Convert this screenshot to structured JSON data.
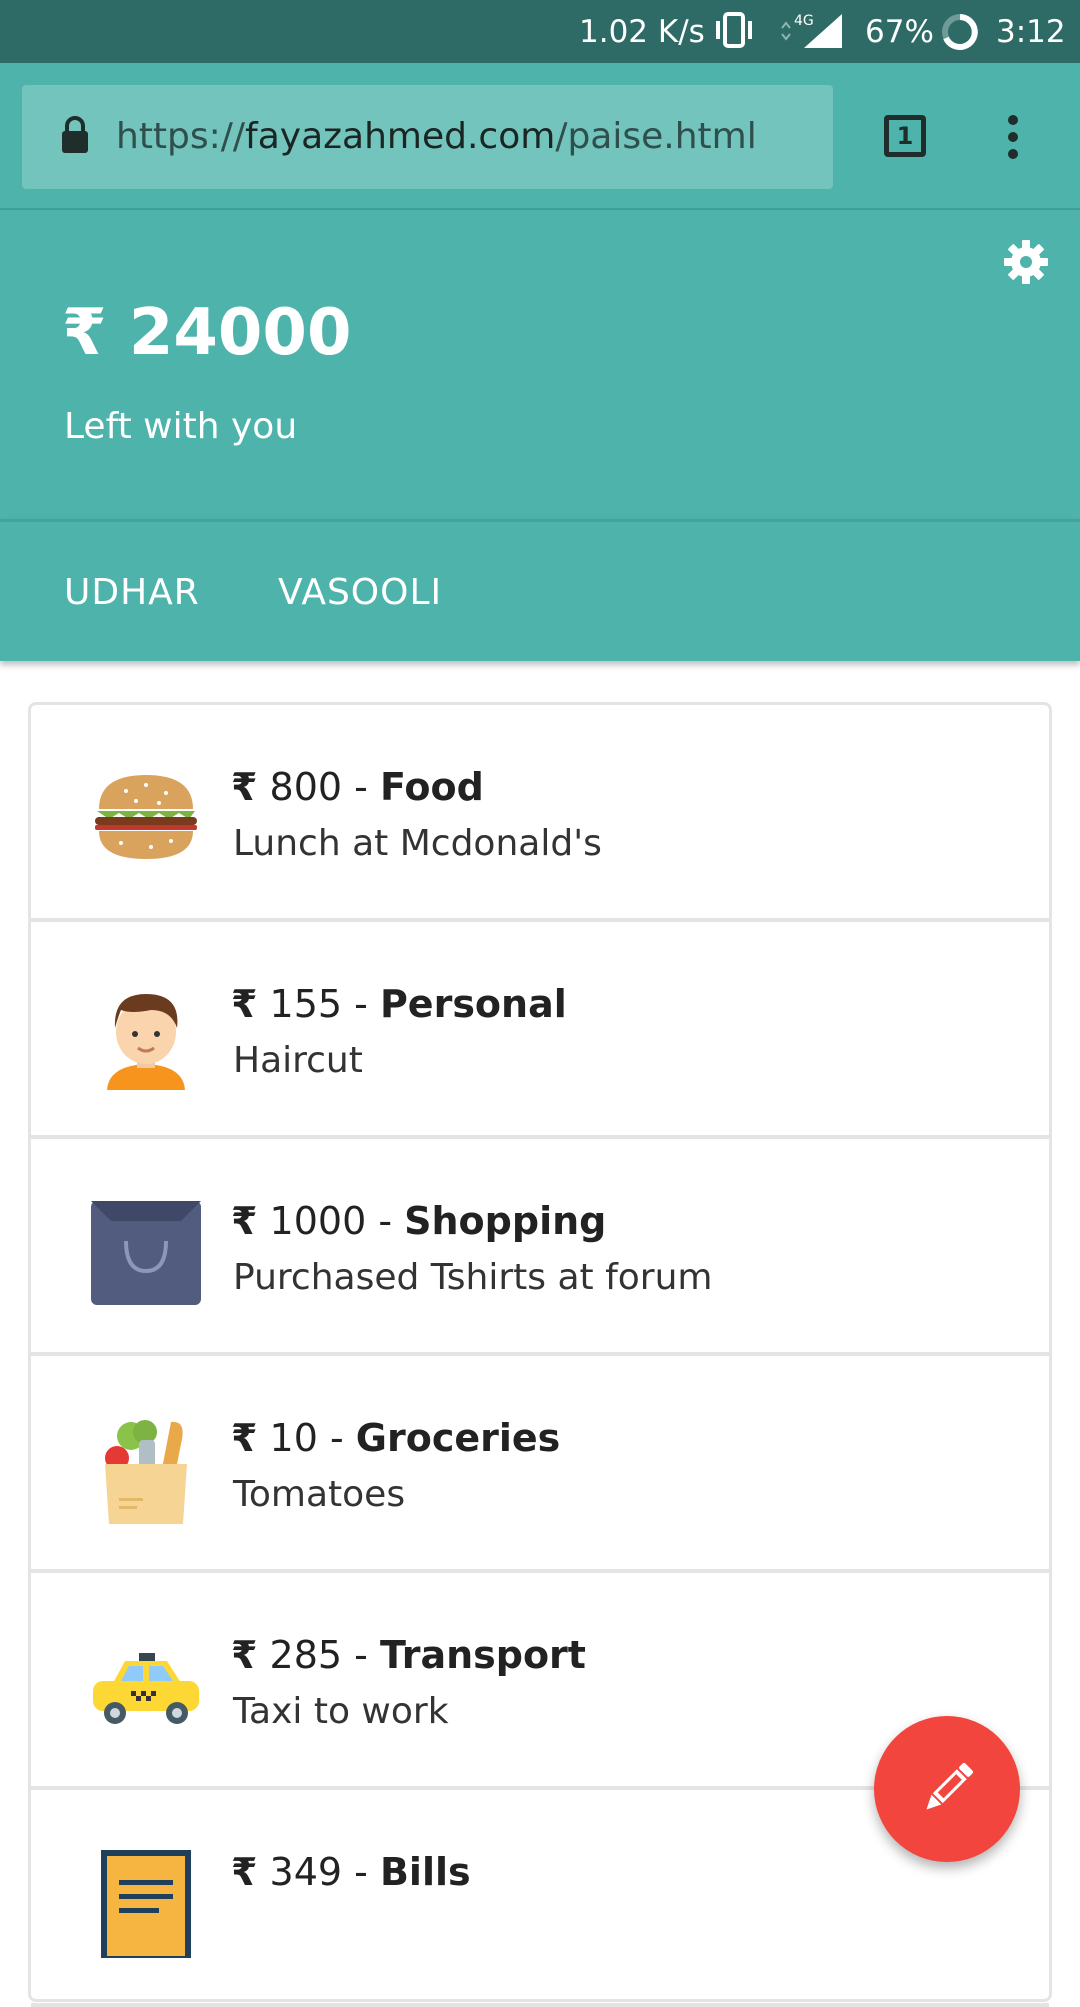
{
  "status_bar": {
    "network_speed": "1.02 K/s",
    "network_type": "4G",
    "battery": "67%",
    "time": "3:12"
  },
  "browser": {
    "url_scheme": "https://",
    "url_domain": "fayazahmed.com",
    "url_path": "/paise.html",
    "tab_count": "1"
  },
  "header": {
    "currency_symbol": "₹",
    "balance_amount": "24000",
    "balance_label": "Left with you",
    "tabs": [
      "UDHAR",
      "VASOOLI"
    ]
  },
  "expenses": [
    {
      "amount": "800",
      "category": "Food",
      "note": "Lunch at Mcdonald's",
      "icon": "burger-icon"
    },
    {
      "amount": "155",
      "category": "Personal",
      "note": "Haircut",
      "icon": "person-avatar-icon"
    },
    {
      "amount": "1000",
      "category": "Shopping",
      "note": "Purchased Tshirts at forum",
      "icon": "shopping-bag-icon"
    },
    {
      "amount": "10",
      "category": "Groceries",
      "note": "Tomatoes",
      "icon": "grocery-bag-icon"
    },
    {
      "amount": "285",
      "category": "Transport",
      "note": "Taxi to work",
      "icon": "taxi-icon"
    },
    {
      "amount": "349",
      "category": "Bills",
      "note": "",
      "icon": "bill-receipt-icon"
    }
  ],
  "colors": {
    "primary": "#4db3ab",
    "status_bar": "#2e6b66",
    "fab": "#f2453d"
  },
  "fab": {
    "icon": "pencil-icon"
  }
}
